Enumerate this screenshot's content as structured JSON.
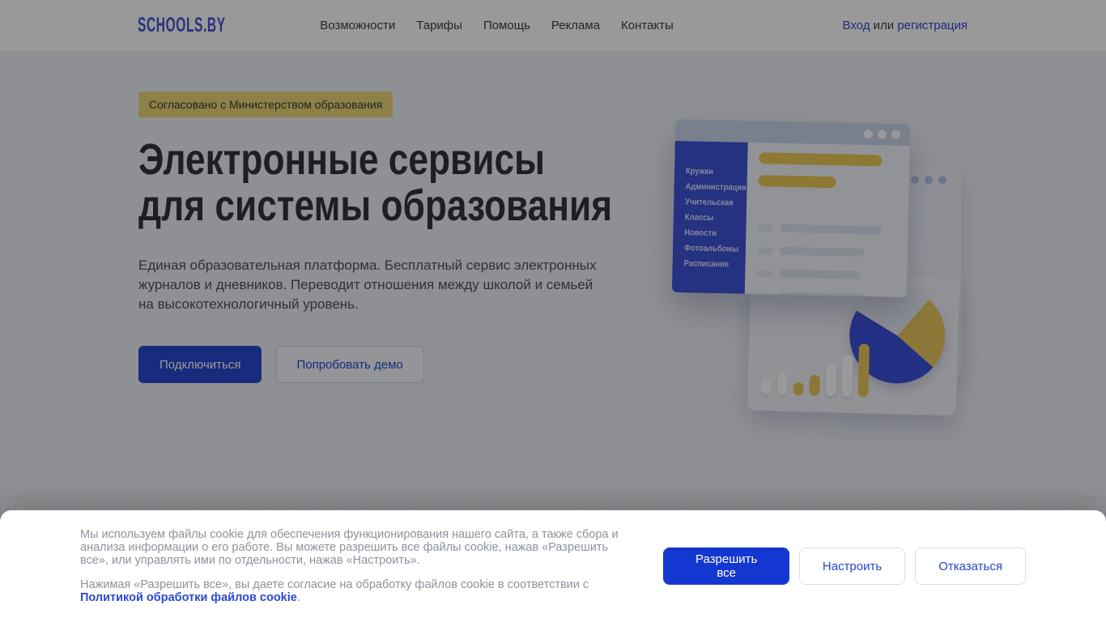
{
  "header": {
    "logo": "SCHOOLS.BY",
    "nav_items": [
      "Возможности",
      "Тарифы",
      "Помощь",
      "Реклама",
      "Контакты"
    ],
    "auth": {
      "login": "Вход",
      "or": " или ",
      "register": "регистрация"
    }
  },
  "hero": {
    "badge": "Согласовано с Министерством образования",
    "title_line1": "Электронные сервисы",
    "title_line2": "для системы образования",
    "description": "Единая образовательная платформа. Бесплатный сервис электронных журналов и дневников. Переводит отношения между школой и семьей на высокотехнологичный уровень.",
    "cta_primary": "Подключиться",
    "cta_secondary": "Попробовать демо"
  },
  "illustration": {
    "sidebar_items": [
      "Кружки",
      "Администрация",
      "Учительская",
      "Классы",
      "Новости",
      "Фотоальбомы",
      "Расписание"
    ]
  },
  "cookie_banner": {
    "paragraph1": "Мы используем файлы cookie для обеспечения функционирования нашего сайта, а также сбора и анализа информации о его работе. Вы можете разрешить все файлы cookie, нажав «Разрешить все», или управлять ими по отдельности, нажав «Настроить».",
    "paragraph2_prefix": "Нажимая «Разрешить все», вы даете согласие на обработку файлов cookie в соответствии с ",
    "paragraph2_link": "Политикой обработки файлов cookie",
    "paragraph2_suffix": ".",
    "buttons": {
      "allow": "Разрешить все",
      "configure": "Настроить",
      "decline": "Отказаться"
    }
  },
  "colors": {
    "accent_blue": "#2c49d4",
    "cookie_button_blue": "#1537d1",
    "badge_yellow": "#ecd67a",
    "illustration_sidebar_blue": "#3f53d8",
    "illustration_yellow": "#ecc957",
    "hero_background": "#eef0f5"
  }
}
